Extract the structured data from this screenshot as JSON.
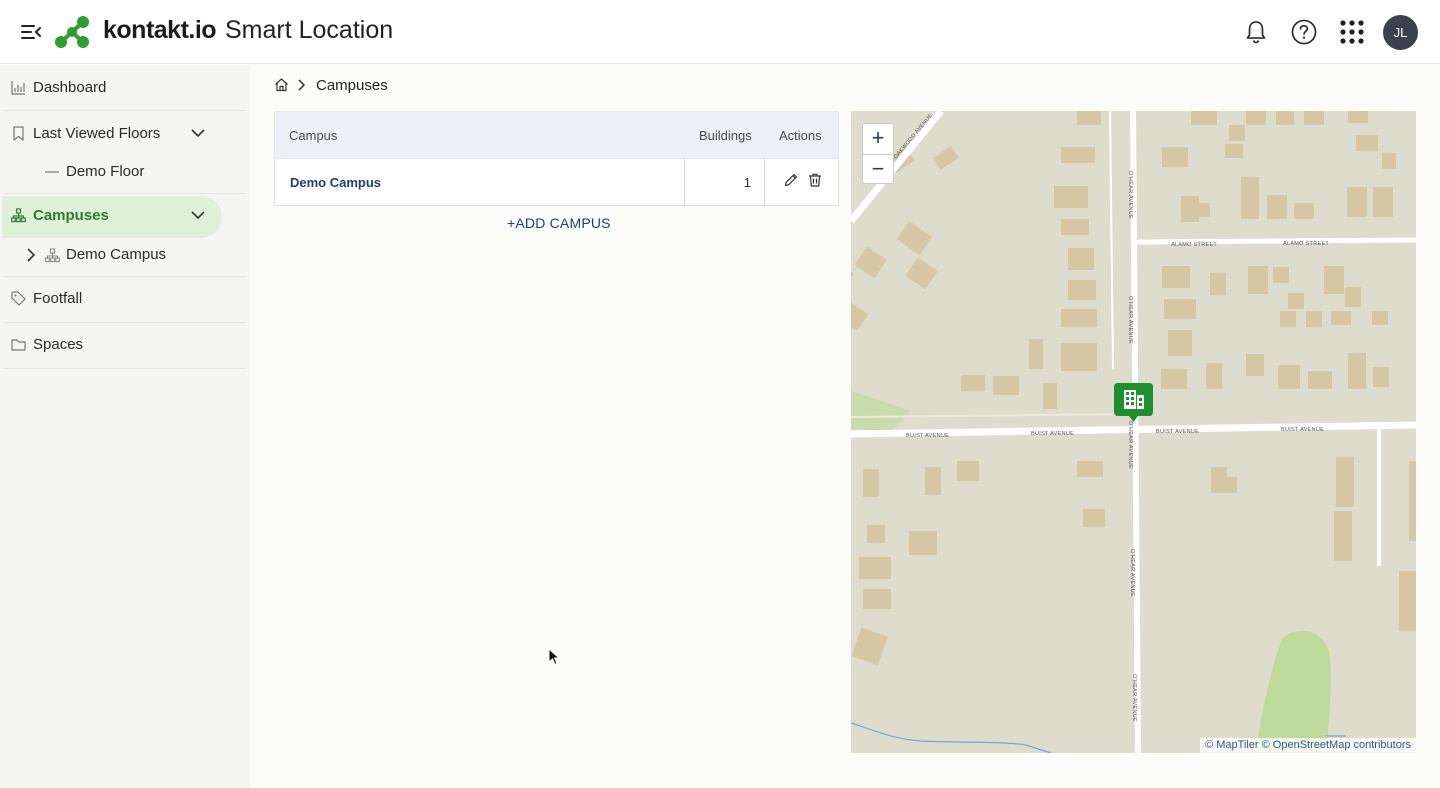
{
  "header": {
    "brand": "kontakt.io",
    "product": "Smart Location",
    "avatar_initials": "JL",
    "accent_color": "#2e9e32"
  },
  "sidebar": {
    "items": [
      {
        "label": "Dashboard",
        "icon": "bar-chart-icon"
      },
      {
        "label": "Last Viewed Floors",
        "icon": "bookmark-icon"
      },
      {
        "label": "Demo Floor",
        "icon": "dash-icon"
      },
      {
        "label": "Campuses",
        "icon": "sitemap-icon",
        "active": true
      },
      {
        "label": "Demo Campus",
        "icon": "sitemap-icon"
      },
      {
        "label": "Footfall",
        "icon": "tag-icon"
      },
      {
        "label": "Spaces",
        "icon": "folder-icon"
      }
    ]
  },
  "breadcrumb": {
    "current": "Campuses"
  },
  "table": {
    "columns": [
      "Campus",
      "Buildings",
      "Actions"
    ],
    "rows": [
      {
        "campus": "Demo Campus",
        "buildings": "1"
      }
    ],
    "add_label": "+ADD CAMPUS"
  },
  "map": {
    "zoom_in": "+",
    "zoom_out": "−",
    "attribution": "© MapTiler © OpenStreetMap contributors",
    "street_labels": [
      "OAKWOOD AVENUE",
      "O'HEAR AVENUE",
      "ALAMO STREET",
      "BUIST AVENUE"
    ],
    "marker_color": "#1e8f2d"
  }
}
